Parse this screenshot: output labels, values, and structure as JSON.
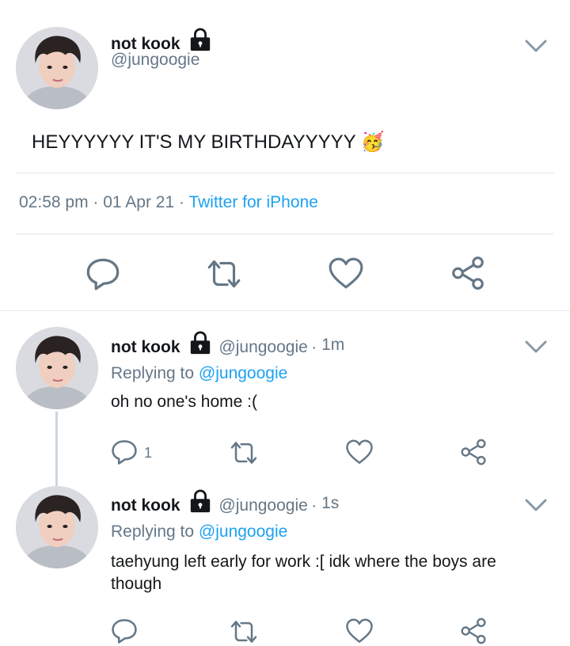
{
  "main_tweet": {
    "name": "not kook",
    "handle": "@jungoogie",
    "text": "HEYYYYYY IT'S MY BIRTHDAYYYYY",
    "emoji": "🥳",
    "time": "02:58 pm",
    "date": "01 Apr 21",
    "client": "Twitter for iPhone",
    "actions": [
      "reply-icon",
      "retweet-icon",
      "like-icon",
      "share-icon"
    ]
  },
  "replies": [
    {
      "name": "not kook",
      "handle": "@jungoogie",
      "age": "1m",
      "replying_prefix": "Replying to",
      "replying_to": "@jungoogie",
      "text": "oh no one's home :(",
      "reply_count": "1"
    },
    {
      "name": "not kook",
      "handle": "@jungoogie",
      "age": "1s",
      "replying_prefix": "Replying to",
      "replying_to": "@jungoogie",
      "text_line1": "taehyung left early for work :[ idk where the boys are",
      "text_line2": "though",
      "reply_count": ""
    }
  ],
  "colors": {
    "text": "#14171a",
    "secondary": "#657786",
    "link": "#1da1f2",
    "divider": "#e1e8ed"
  }
}
